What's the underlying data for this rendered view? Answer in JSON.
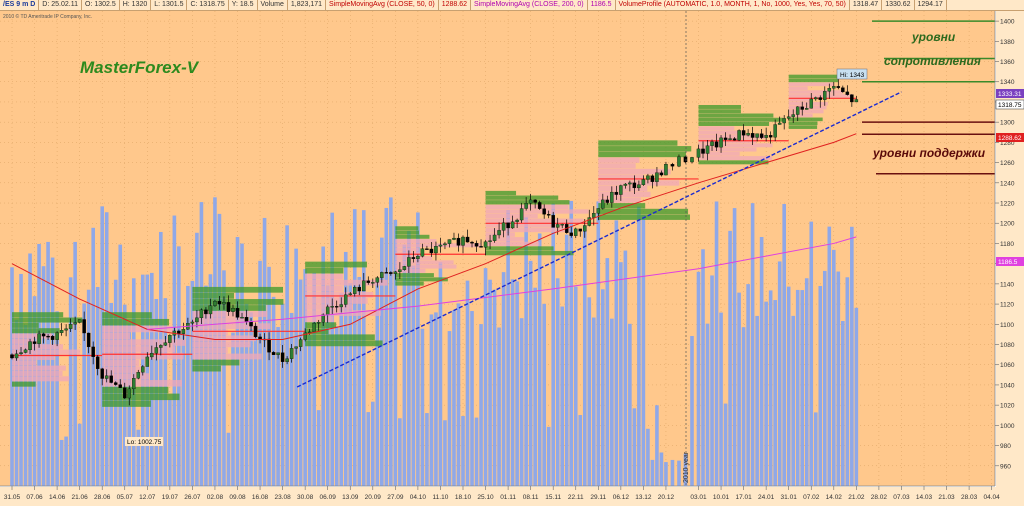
{
  "header": {
    "symbol": "/ES 9 m D",
    "date": "D: 25.02.11",
    "open": "O: 1302.5",
    "high": "H: 1320",
    "low": "L: 1301.5",
    "close": "C: 1318.75",
    "change": "Y: 18.5",
    "volume_label": "Volume",
    "volume_value": "1,823,171",
    "sma50_label": "SimpleMovingAvg (CLOSE, 50, 0)",
    "sma50_value": "1288.62",
    "sma200_label": "SimpleMovingAvg (CLOSE, 200, 0)",
    "sma200_value": "1186.5",
    "vp_label": "VolumeProfile (AUTOMATIC, 1.0, MONTH, 1, No, 1000, Yes, Yes, 70, 50)",
    "vp_values": [
      "1318.47",
      "1330.62",
      "1294.17"
    ]
  },
  "copyright": "2010 © TD Ameritrade IP Company, Inc.",
  "watermark": "MasterForex-V",
  "annotations": {
    "resistance_line1": "уровни",
    "resistance_line2": "сопротивления",
    "support": "уровни   поддержки",
    "high_tag": "Hi: 1343",
    "low_tag": "Lo: 1002.75",
    "year_marker": "2010 year"
  },
  "price_tags": {
    "purple": "1333.31",
    "current": "1318.75",
    "red": "1288.62",
    "magenta": "1186.5"
  },
  "colors": {
    "background": "#ffc88c",
    "volume": "#8fa8e8",
    "bull": "#2e7d32",
    "bear": "#000000",
    "sma50": "#e02020",
    "sma200": "#e040e0",
    "trend": "#1a2ad0",
    "profile_green": "#3c9a2a",
    "profile_pink": "#f0a8b8",
    "level_line": "#6a1010"
  },
  "chart_data": {
    "type": "line",
    "title": "",
    "ylim": [
      940,
      1410
    ],
    "y_ticks": [
      960,
      980,
      1000,
      1020,
      1040,
      1060,
      1080,
      1100,
      1120,
      1140,
      1160,
      1180,
      1200,
      1220,
      1240,
      1260,
      1280,
      1300,
      1320,
      1340,
      1360,
      1380,
      1400
    ],
    "x_tick_labels": [
      "31.05",
      "07.06",
      "14.06",
      "21.06",
      "28.06",
      "05.07",
      "12.07",
      "19.07",
      "26.07",
      "02.08",
      "09.08",
      "16.08",
      "23.08",
      "30.08",
      "06.09",
      "13.09",
      "20.09",
      "27.09",
      "04.10",
      "11.10",
      "18.10",
      "25.10",
      "01.11",
      "08.11",
      "15.11",
      "22.11",
      "29.11",
      "06.12",
      "13.12",
      "20.12",
      "03.01",
      "10.01",
      "17.01",
      "24.01",
      "31.01",
      "07.02",
      "14.02",
      "21.02",
      "28.02",
      "07.03",
      "14.03",
      "21.03",
      "28.03",
      "04.04"
    ],
    "series": [
      {
        "name": "Close",
        "x": [
          "31.05",
          "07.06",
          "14.06",
          "21.06",
          "28.06",
          "05.07",
          "12.07",
          "19.07",
          "26.07",
          "02.08",
          "09.08",
          "16.08",
          "23.08",
          "30.08",
          "06.09",
          "13.09",
          "20.09",
          "27.09",
          "04.10",
          "11.10",
          "18.10",
          "25.10",
          "01.11",
          "08.11",
          "15.11",
          "22.11",
          "29.11",
          "06.12",
          "13.12",
          "20.12",
          "03.01",
          "10.01",
          "17.01",
          "24.01",
          "31.01",
          "07.02",
          "14.02",
          "21.02"
        ],
        "values": [
          1070,
          1085,
          1090,
          1100,
          1050,
          1030,
          1070,
          1090,
          1100,
          1125,
          1110,
          1085,
          1065,
          1090,
          1115,
          1130,
          1145,
          1150,
          1170,
          1175,
          1185,
          1180,
          1200,
          1220,
          1200,
          1190,
          1215,
          1235,
          1240,
          1255,
          1270,
          1280,
          1290,
          1285,
          1305,
          1320,
          1335,
          1318.75
        ]
      },
      {
        "name": "SimpleMovingAvg (CLOSE, 50, 0)",
        "x": [
          "31.05",
          "21.06",
          "12.07",
          "02.08",
          "23.08",
          "13.09",
          "04.10",
          "25.10",
          "15.11",
          "06.12",
          "03.01",
          "24.01",
          "14.02",
          "21.02"
        ],
        "values": [
          1160,
          1125,
          1095,
          1085,
          1085,
          1100,
          1135,
          1160,
          1190,
          1215,
          1240,
          1260,
          1280,
          1288.62
        ]
      },
      {
        "name": "SimpleMovingAvg (CLOSE, 200, 0)",
        "x": [
          "12.07",
          "23.08",
          "04.10",
          "15.11",
          "03.01",
          "14.02",
          "21.02"
        ],
        "values": [
          1095,
          1105,
          1118,
          1135,
          1155,
          1180,
          1186.5
        ]
      }
    ]
  }
}
